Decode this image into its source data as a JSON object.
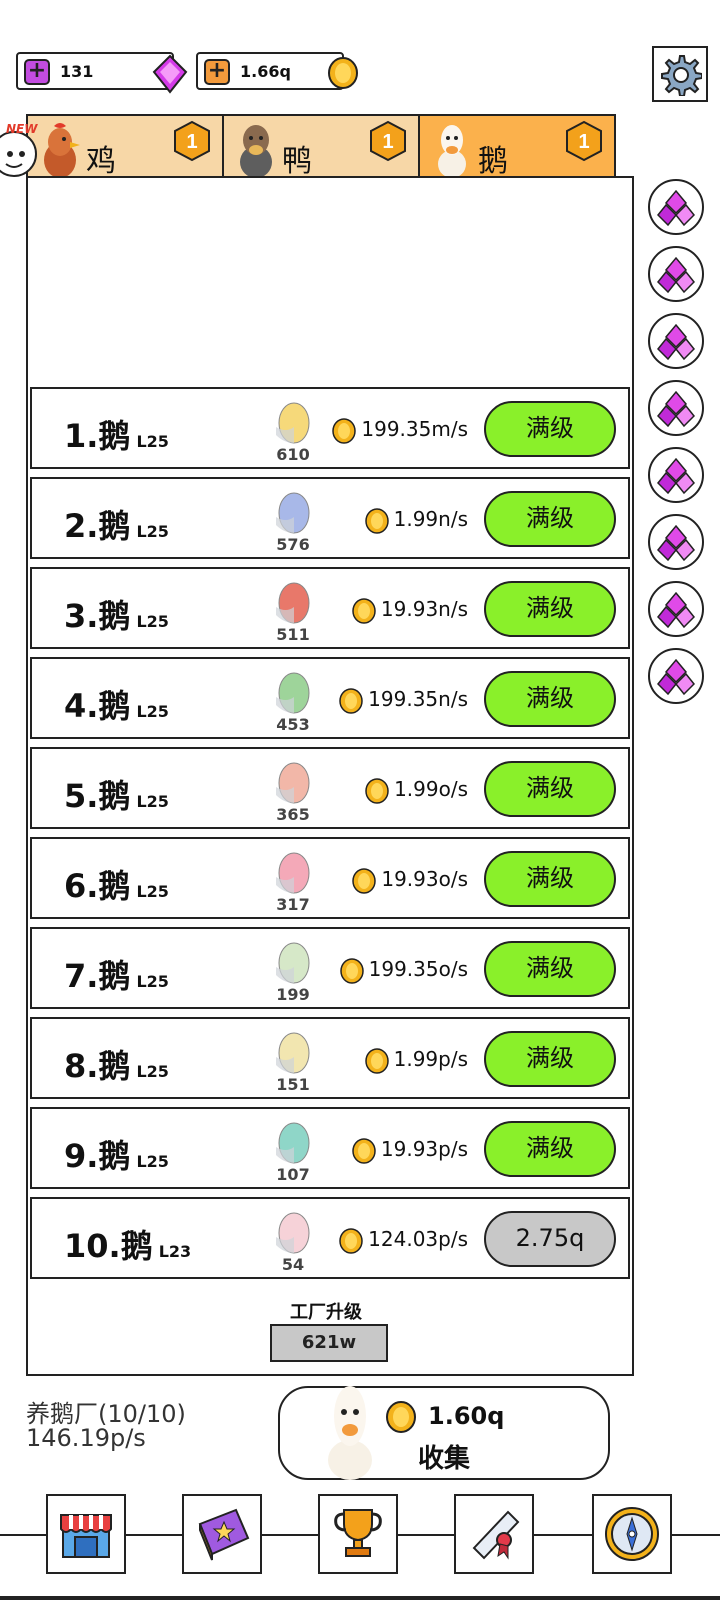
{
  "currencies": {
    "gems": "131",
    "coins": "1.66q"
  },
  "tabs": [
    {
      "label": "鸡",
      "badge": "1"
    },
    {
      "label": "鸭",
      "badge": "1"
    },
    {
      "label": "鹅",
      "badge": "1"
    }
  ],
  "new_tag": "NEW",
  "rows": [
    {
      "name": "1.鹅",
      "level": "L25",
      "count": "610",
      "rate": "199.35m/s",
      "button": "满级",
      "egg_color": "#f6d97a"
    },
    {
      "name": "2.鹅",
      "level": "L25",
      "count": "576",
      "rate": "1.99n/s",
      "button": "满级",
      "egg_color": "#a8b8e8"
    },
    {
      "name": "3.鹅",
      "level": "L25",
      "count": "511",
      "rate": "19.93n/s",
      "button": "满级",
      "egg_color": "#e8786a"
    },
    {
      "name": "4.鹅",
      "level": "L25",
      "count": "453",
      "rate": "199.35n/s",
      "button": "满级",
      "egg_color": "#9ed49a"
    },
    {
      "name": "5.鹅",
      "level": "L25",
      "count": "365",
      "rate": "1.99o/s",
      "button": "满级",
      "egg_color": "#f2b7a8"
    },
    {
      "name": "6.鹅",
      "level": "L25",
      "count": "317",
      "rate": "19.93o/s",
      "button": "满级",
      "egg_color": "#f4a9b8"
    },
    {
      "name": "7.鹅",
      "level": "L25",
      "count": "199",
      "rate": "199.35o/s",
      "button": "满级",
      "egg_color": "#d6e8c8"
    },
    {
      "name": "8.鹅",
      "level": "L25",
      "count": "151",
      "rate": "1.99p/s",
      "button": "满级",
      "egg_color": "#f2e6b0"
    },
    {
      "name": "9.鹅",
      "level": "L25",
      "count": "107",
      "rate": "19.93p/s",
      "button": "满级",
      "egg_color": "#8fd6c8"
    },
    {
      "name": "10.鹅",
      "level": "L23",
      "count": "54",
      "rate": "124.03p/s",
      "button": "2.75q",
      "egg_color": "#f6d2d8"
    }
  ],
  "factory": {
    "label": "工厂升级",
    "cost": "621w"
  },
  "farm": {
    "name": "养鹅厂(10/10)",
    "rate": "146.19p/s"
  },
  "collect": {
    "amount": "1.60q",
    "label": "收集"
  },
  "nav": [
    "shop-icon",
    "book-icon",
    "trophy-icon",
    "scroll-icon",
    "compass-icon"
  ],
  "colors": {
    "tab_active": "#fbb14c",
    "tab_inactive": "#f7d7a7",
    "max_button": "#8af02a",
    "gem_purple": "#c02ad8",
    "coin_gold": "#f3b21b"
  }
}
